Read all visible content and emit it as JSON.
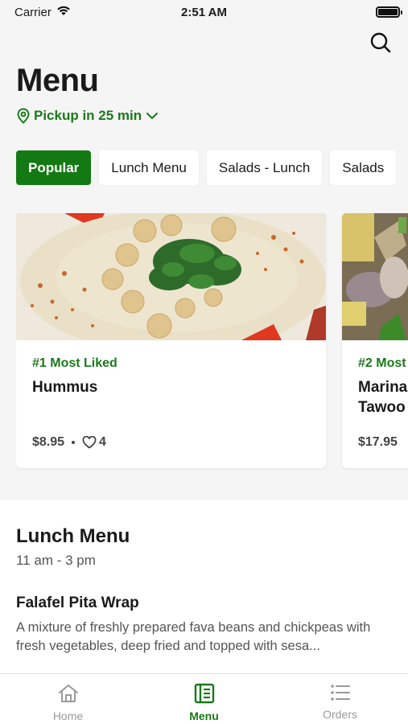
{
  "status_bar": {
    "carrier": "Carrier",
    "time": "2:51 AM"
  },
  "header": {
    "title": "Menu",
    "pickup": "Pickup in 25 min"
  },
  "colors": {
    "accent": "#137a13",
    "accent_text": "#1a7a1a"
  },
  "category_tabs": [
    {
      "label": "Popular",
      "active": true
    },
    {
      "label": "Lunch Menu",
      "active": false
    },
    {
      "label": "Salads - Lunch",
      "active": false
    },
    {
      "label": "Salads",
      "active": false
    }
  ],
  "popular_items": [
    {
      "rank": "#1 Most Liked",
      "name": "Hummus",
      "price": "$8.95",
      "likes": "4"
    },
    {
      "rank": "#2 Most",
      "name": "Marina\nTawoo",
      "price": "$17.95"
    }
  ],
  "lunch_section": {
    "title": "Lunch Menu",
    "hours": "11 am - 3 pm",
    "first_item": {
      "name": "Falafel Pita Wrap",
      "description": "A mixture of freshly prepared fava beans and chickpeas with fresh vegetables, deep fried and topped with sesa..."
    }
  },
  "bottom_nav": [
    {
      "label": "Home",
      "icon": "home-icon",
      "active": false
    },
    {
      "label": "Menu",
      "icon": "menu-book-icon",
      "active": true
    },
    {
      "label": "Orders",
      "icon": "list-icon",
      "active": false
    }
  ]
}
